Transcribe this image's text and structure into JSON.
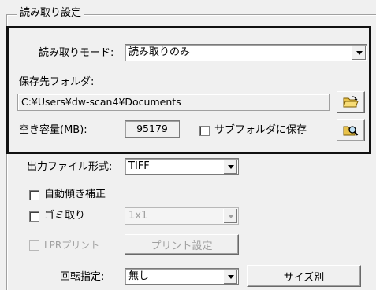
{
  "group_title": "読み取り設定",
  "read_mode": {
    "label": "読み取りモード:",
    "value": "読み取りのみ"
  },
  "save_folder": {
    "label": "保存先フォルダ:",
    "path": "C:¥Users¥dw-scan4¥Documents",
    "browse_icon": "folder-open-icon",
    "search_icon": "magnifier-icon"
  },
  "free_space": {
    "label": "空き容量(MB):",
    "value": "95179"
  },
  "subfolder": {
    "label": "サブフォルダに保存",
    "checked": false
  },
  "output_format": {
    "label": "出力ファイル形式:",
    "value": "TIFF"
  },
  "auto_deskew": {
    "label": "自動傾き補正",
    "checked": false
  },
  "dust_removal": {
    "label": "ゴミ取り",
    "checked": false,
    "value": "1x1"
  },
  "lpr_print": {
    "label": "LPRプリント",
    "checked": false,
    "enabled": false
  },
  "print_settings": {
    "label": "プリント設定"
  },
  "rotation": {
    "label": "回転指定:",
    "value": "無し"
  },
  "size_button": {
    "label": "サイズ別"
  }
}
